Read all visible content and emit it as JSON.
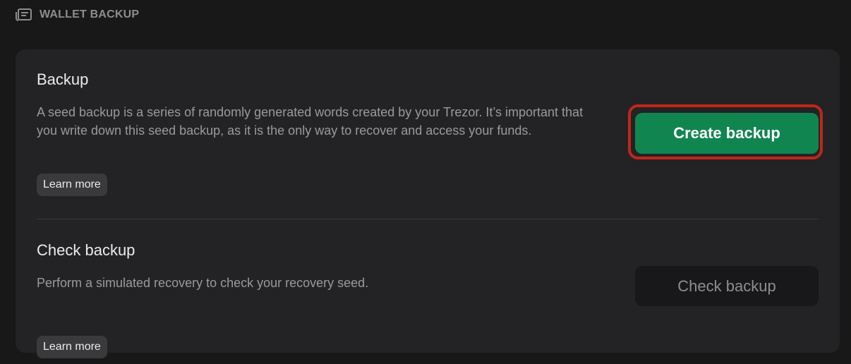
{
  "header": {
    "icon": "backup-list-icon",
    "title": "WALLET BACKUP"
  },
  "backup": {
    "title": "Backup",
    "description": "A seed backup is a series of randomly generated words created by your Trezor. It’s important that you write down this seed backup, as it is the only way to recover and access your funds.",
    "learn_more": "Learn more",
    "button_label": "Create backup"
  },
  "check_backup": {
    "title": "Check backup",
    "description": "Perform a simulated recovery to check your recovery seed.",
    "learn_more": "Learn more",
    "button_label": "Check backup"
  },
  "colors": {
    "background": "#181819",
    "card": "#232325",
    "primary_button": "#118550",
    "highlight_ring": "#c1261a",
    "secondary_button": "#18181a"
  }
}
